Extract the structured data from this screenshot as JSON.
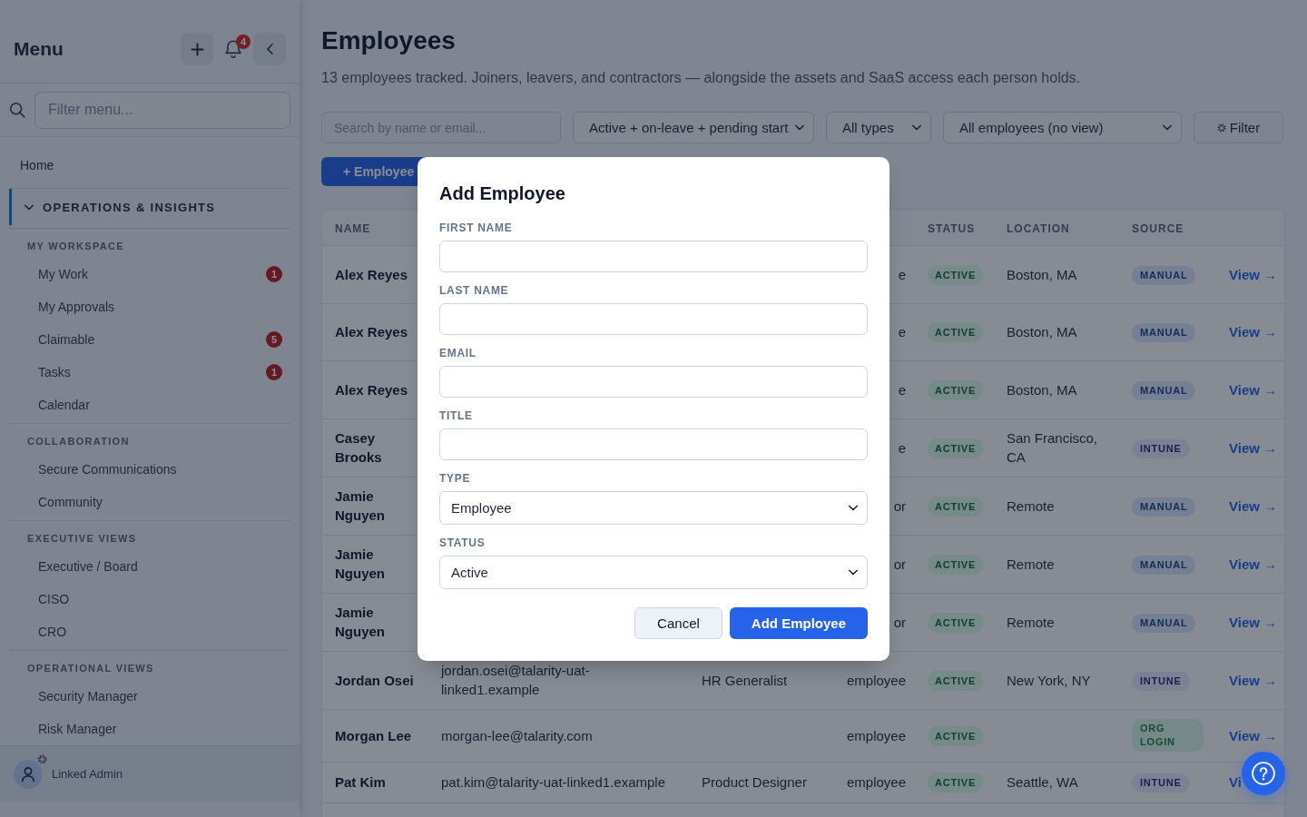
{
  "sidebar": {
    "title": "Menu",
    "notification_count": "4",
    "search": {
      "placeholder": "Filter menu..."
    },
    "nav": [
      {
        "kind": "link",
        "label": "Home",
        "selected": false
      },
      {
        "kind": "section",
        "label": "OPERATIONS & INSIGHTS",
        "selected": true,
        "expanded": true,
        "groups": [
          {
            "label": "MY WORKSPACE",
            "items": [
              {
                "label": "My Work",
                "badge": "1",
                "selected": false
              },
              {
                "label": "My Approvals",
                "selected": false
              },
              {
                "label": "Claimable",
                "badge": "5",
                "selected": false
              },
              {
                "label": "Tasks",
                "badge": "1",
                "selected": false
              },
              {
                "label": "Calendar",
                "selected": false
              }
            ]
          },
          {
            "label": "COLLABORATION",
            "items": [
              {
                "label": "Secure Communications",
                "selected": false
              },
              {
                "label": "Community",
                "selected": false
              }
            ]
          },
          {
            "label": "EXECUTIVE VIEWS",
            "items": [
              {
                "label": "Executive / Board",
                "selected": false
              },
              {
                "label": "CISO",
                "selected": false
              },
              {
                "label": "CRO",
                "selected": false
              }
            ]
          },
          {
            "label": "OPERATIONAL VIEWS",
            "items": [
              {
                "label": "Security Manager",
                "selected": false
              },
              {
                "label": "Risk Manager",
                "selected": false
              }
            ]
          }
        ]
      }
    ],
    "user": {
      "name": "Linked Admin"
    }
  },
  "page": {
    "title": "Employees",
    "subtitle": "13 employees tracked. Joiners, leavers, and contractors — alongside the assets and SaaS access each person holds.",
    "filters": [
      {
        "kind": "search",
        "placeholder": "Search by name or email..."
      },
      {
        "kind": "select",
        "value": "Active + on-leave + pending start"
      },
      {
        "kind": "select",
        "value": "All types"
      },
      {
        "kind": "select",
        "value": "All employees (no view)"
      },
      {
        "kind": "button",
        "label": "Filter"
      }
    ],
    "add_button": "+ Employee"
  },
  "table": {
    "columns": [
      {
        "label": "NAME"
      },
      {
        "label": "STATUS"
      },
      {
        "label": "LOCATION"
      },
      {
        "label": "SOURCE"
      }
    ],
    "rows": [
      {
        "name": "Alex Reyes",
        "type": "e",
        "status": "ACTIVE",
        "location": "Boston, MA",
        "source": {
          "label": "MANUAL",
          "color": "#758094"
        },
        "link": "View →"
      },
      {
        "name": "Alex Reyes",
        "type": "e",
        "status": "ACTIVE",
        "location": "Boston, MA",
        "source": {
          "label": "MANUAL",
          "color": "#758094"
        },
        "link": "View →"
      },
      {
        "name": "Alex Reyes",
        "type": "e",
        "status": "ACTIVE",
        "location": "Boston, MA",
        "source": {
          "label": "MANUAL",
          "color": "#758094"
        },
        "link": "View →"
      },
      {
        "name": "Casey Brooks",
        "type": "e",
        "status": "ACTIVE",
        "location": "San Francisco, CA",
        "source": {
          "label": "INTUNE",
          "color": "#7e8094"
        },
        "link": "View →"
      },
      {
        "name": "Jamie Nguyen",
        "type": "or",
        "status": "ACTIVE",
        "location": "Remote",
        "source": {
          "label": "MANUAL",
          "color": "#758094"
        },
        "link": "View →"
      },
      {
        "name": "Jamie Nguyen",
        "type": "or",
        "status": "ACTIVE",
        "location": "Remote",
        "source": {
          "label": "MANUAL",
          "color": "#758094"
        },
        "link": "View →"
      },
      {
        "name": "Jamie Nguyen",
        "type": "or",
        "status": "ACTIVE",
        "location": "Remote",
        "source": {
          "label": "MANUAL",
          "color": "#758094"
        },
        "link": "View →"
      },
      {
        "name": "Jordan Osei",
        "email": "jordan.osei@talarity-uat-linked1.example",
        "title": "HR Generalist",
        "type": "employee",
        "status": "ACTIVE",
        "location": "New York, NY",
        "source": {
          "label": "INTUNE",
          "color": "#7e8094"
        },
        "link": "View →"
      },
      {
        "name": "Morgan Lee",
        "email": "morgan-lee@talarity.com",
        "type": "employee",
        "status": "ACTIVE",
        "source": {
          "label": "ORG LOGIN",
          "color": "#758988"
        },
        "link": "View →"
      },
      {
        "name": "Pat Kim",
        "email": "pat.kim@talarity-uat-linked1.example",
        "title": "Product Designer",
        "type": "employee",
        "status": "ACTIVE",
        "location": "Seattle, WA",
        "source": {
          "label": "INTUNE",
          "color": "#7e8094"
        },
        "link": "Vi"
      }
    ]
  },
  "modal": {
    "title": "Add Employee",
    "fields": [
      {
        "kind": "text",
        "label": "FIRST NAME"
      },
      {
        "kind": "text",
        "label": "LAST NAME"
      },
      {
        "kind": "text",
        "label": "EMAIL"
      },
      {
        "kind": "text",
        "label": "TITLE"
      },
      {
        "kind": "select",
        "label": "TYPE",
        "value": "Employee"
      },
      {
        "kind": "select",
        "label": "STATUS",
        "value": "Active"
      }
    ],
    "buttons": [
      {
        "kind": "secondary",
        "label": "Cancel"
      },
      {
        "kind": "primary",
        "label": "Add Employee"
      }
    ]
  }
}
